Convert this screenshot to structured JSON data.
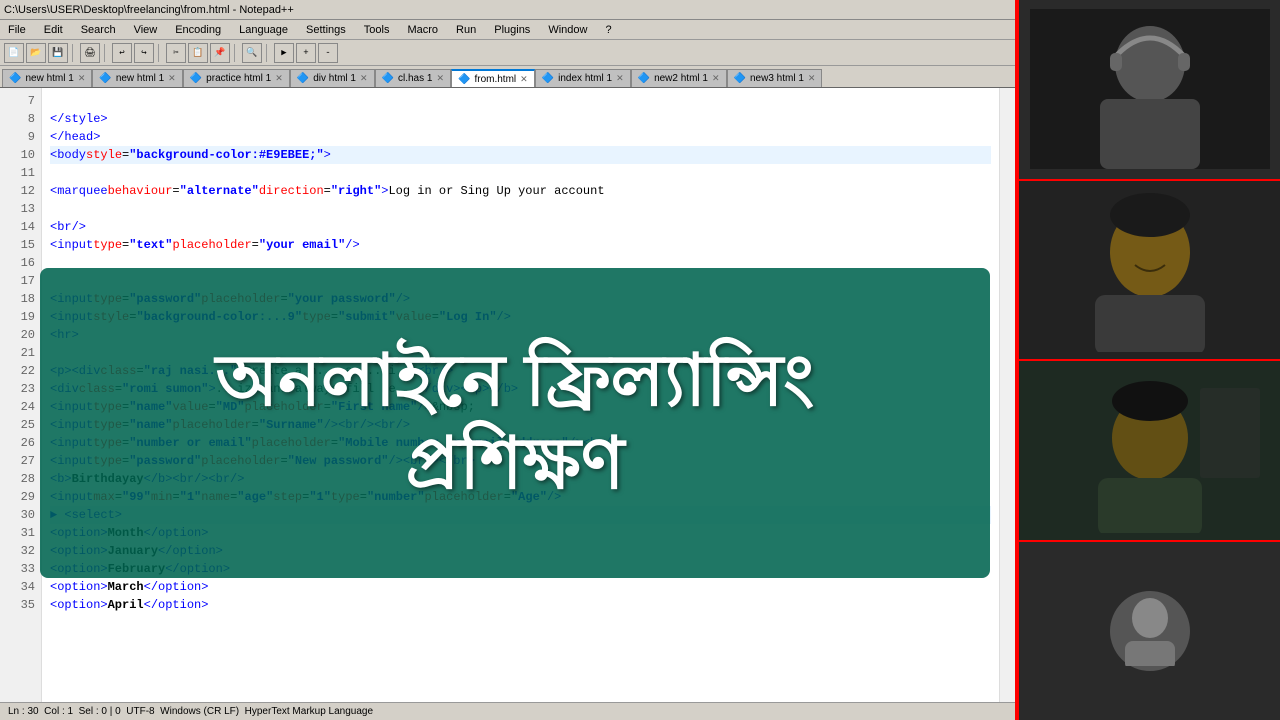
{
  "window": {
    "title": "C:\\Users\\USER\\Desktop\\freelancing\\from.html - Notepad++",
    "menu_items": [
      "File",
      "Edit",
      "Search",
      "View",
      "Encoding",
      "Language",
      "Settings",
      "Tools",
      "Macro",
      "Run",
      "Plugins",
      "Window",
      "?"
    ]
  },
  "tabs": [
    {
      "label": "new html 1",
      "active": false
    },
    {
      "label": "new html 1",
      "active": false
    },
    {
      "label": "practice html 1",
      "active": false
    },
    {
      "label": "div html 1",
      "active": false
    },
    {
      "label": "cl.has 1",
      "active": false
    },
    {
      "label": "from.html",
      "active": true
    },
    {
      "label": "index html 1",
      "active": false
    },
    {
      "label": "new2 html 1",
      "active": false
    },
    {
      "label": "new3 html 1",
      "active": false
    }
  ],
  "code_lines": [
    {
      "num": 7,
      "content": ""
    },
    {
      "num": 8,
      "html": "<span class='tag'>&lt;/style&gt;</span>"
    },
    {
      "num": 9,
      "html": "<span class='tag'>&lt;/head&gt;</span>"
    },
    {
      "num": 10,
      "html": "<span class='tag'>&lt;body</span> <span class='attr-name'>style</span>=<span class='attr-val'>\"background-color:#E9EBEE;\"</span><span class='tag'>&gt;</span>",
      "highlighted": true
    },
    {
      "num": 11,
      "content": ""
    },
    {
      "num": 12,
      "html": "<span class='tag'>&lt;marquee</span> <span class='attr-name'>behaviour</span>=<span class='attr-val'>\"alternate\"</span> <span class='attr-name'>direction</span>=<span class='attr-val'>\"right\"</span><span class='tag'>&gt;</span><span class='text-content'>Log in or Sing Up your account</span>"
    },
    {
      "num": 13,
      "content": ""
    },
    {
      "num": 14,
      "html": "<span class='tag'>&lt;br/&gt;</span>"
    },
    {
      "num": 15,
      "html": "<span class='tag'>&lt;input</span> <span class='attr-name'>type</span>=<span class='attr-val'>\"text\"</span> <span class='attr-name'>placeholder</span>=<span class='attr-val'>\"your email\"</span><span class='tag'>/&gt;</span>"
    },
    {
      "num": 16,
      "content": ""
    },
    {
      "num": 17,
      "content": ""
    },
    {
      "num": 18,
      "html": "<span class='tag'>&lt;input</span> <span class='attr-name'>type</span>=<span class='attr-val'>\"password\"</span> <span class='attr-name'>placeholder</span>=<span class='attr-val'>\"your password\"</span><span class='tag'>/&gt;</span>"
    },
    {
      "num": 19,
      "html": "<span class='tag'>&lt;input</span> <span class='attr-name'>style</span>=<span class='attr-val'>\"background-color:...9\"</span> <span class='attr-name'>type</span>=<span class='attr-val'>\"submit\"</span> <span class='attr-name'>value</span>=<span class='attr-val'>\"Log In\"</span><span class='tag'>/&gt;</span>"
    },
    {
      "num": 20,
      "html": "<span class='tag'>&lt;hr</span><span class='tag'>&gt;</span>"
    },
    {
      "num": 21,
      "content": ""
    },
    {
      "num": 22,
      "html": "<span class='tag'>&lt;p&gt;&lt;div</span> <span class='attr-name'>class</span>=<span class='attr-val'>\"raj nasi...\"</span><span class='tag'>&gt;</span><span class='text-content'>Create a n... a ...di...</span><span class='tag'>&lt;br/&gt;</span>"
    },
    {
      "num": 23,
      "html": "<span class='tag'>&lt;div</span> <span class='attr-name'>class</span>=<span class='attr-val'>\"romi sumon\"</span><span class='tag'>&gt;</span><span class='text-content'>...ize and always fill be...</span><span class='tag'>&lt;/div&gt;&lt;/p&gt;&lt;/b&gt;</span>"
    },
    {
      "num": 24,
      "html": "<span class='tag'>&lt;input</span> <span class='attr-name'>type</span>=<span class='attr-val'>\"name\"</span> <span class='attr-name'>value</span>=<span class='attr-val'>\"MD\"</span> <span class='attr-name'>placeholder</span>=<span class='attr-val'>\"First name\"</span><span class='tag'>/&gt;</span>&amp;nbsp;"
    },
    {
      "num": 25,
      "html": "<span class='tag'>&lt;input</span> <span class='attr-name'>type</span>=<span class='attr-val'>\"name\"</span> <span class='attr-name'>placeholder</span>=<span class='attr-val'>\"Surname\"</span><span class='tag'>/&gt;&lt;br/&gt;&lt;br/&gt;</span>"
    },
    {
      "num": 26,
      "html": "<span class='tag'>&lt;input</span> <span class='attr-name'>type</span>=<span class='attr-val'>\"number or email\"</span> <span class='attr-name'>placeholder</span>=<span class='attr-val'>\"Mobile number or email address\"</span><span class='tag'>/&gt;&lt;br/</span>"
    },
    {
      "num": 27,
      "html": "<span class='tag'>&lt;input</span> <span class='attr-name'>type</span>=<span class='attr-val'>\"password\"</span> <span class='attr-name'>placeholder</span>=<span class='attr-val'>\"New password\"</span><span class='tag'>/&gt;&lt;br/&gt;&lt;/br&gt;</span>"
    },
    {
      "num": 28,
      "html": "<span class='tag'>&lt;b&gt;</span><span class='bold-text'>Birthdayay</span><span class='tag'>&lt;/b&gt;&lt;br/&gt;&lt;br/&gt;</span>"
    },
    {
      "num": 29,
      "html": "<span class='tag'>&lt;input</span> <span class='attr-name'>max</span>=<span class='attr-val'>\"99\"</span> <span class='attr-name'>min</span>=<span class='attr-val'>\"1\"</span> <span class='attr-name'>name</span>=<span class='attr-val'>\"age\"</span> <span class='attr-name'>step</span>=<span class='attr-val'>\"1\"</span> <span class='attr-name'>type</span>=<span class='attr-val'>\"number\"</span> <span class='attr-name'>placeholder</span>=<span class='attr-val'>\"Age\"</span> <span class='tag'>/&gt;</span>"
    },
    {
      "num": 30,
      "html": "<span class='tag'>&#9658; &lt;select&gt;</span>",
      "highlighted": true
    },
    {
      "num": 31,
      "html": "<span class='tag'>&lt;option&gt;</span><span class='bold-text'>Month</span><span class='tag'>&lt;/option&gt;</span>"
    },
    {
      "num": 32,
      "html": "<span class='tag'>&lt;option&gt;</span><span class='bold-text'>January</span><span class='tag'>&lt;/option&gt;</span>"
    },
    {
      "num": 33,
      "html": "<span class='tag'>&lt;option&gt;</span><span class='bold-text'>February</span><span class='tag'>&lt;/option&gt;</span>"
    },
    {
      "num": 34,
      "html": "<span class='tag'>&lt;option&gt;</span><span class='bold-text'>March</span><span class='tag'>&lt;/option&gt;</span>"
    },
    {
      "num": 35,
      "html": "<span class='tag'>&lt;option&gt;</span><span class='bold-text'>April</span><span class='tag'>&lt;/option&gt;</span>"
    }
  ],
  "overlay": {
    "line1": "অনলাইনে ফ্রিল্যান্সিং",
    "line2": "প্রশিক্ষণ"
  },
  "video_panel": {
    "cells": [
      {
        "id": "video-1",
        "type": "person-headphones"
      },
      {
        "id": "video-2",
        "type": "person-smiling"
      },
      {
        "id": "video-3",
        "type": "person-dark"
      },
      {
        "id": "video-4",
        "type": "avatar-placeholder"
      }
    ]
  },
  "status": {
    "ln": "Ln : 30",
    "col": "Col : 1",
    "sel": "Sel : 0 | 0",
    "encoding": "UTF-8",
    "eol": "Windows (CR LF)",
    "type": "HyperText Markup Language"
  }
}
